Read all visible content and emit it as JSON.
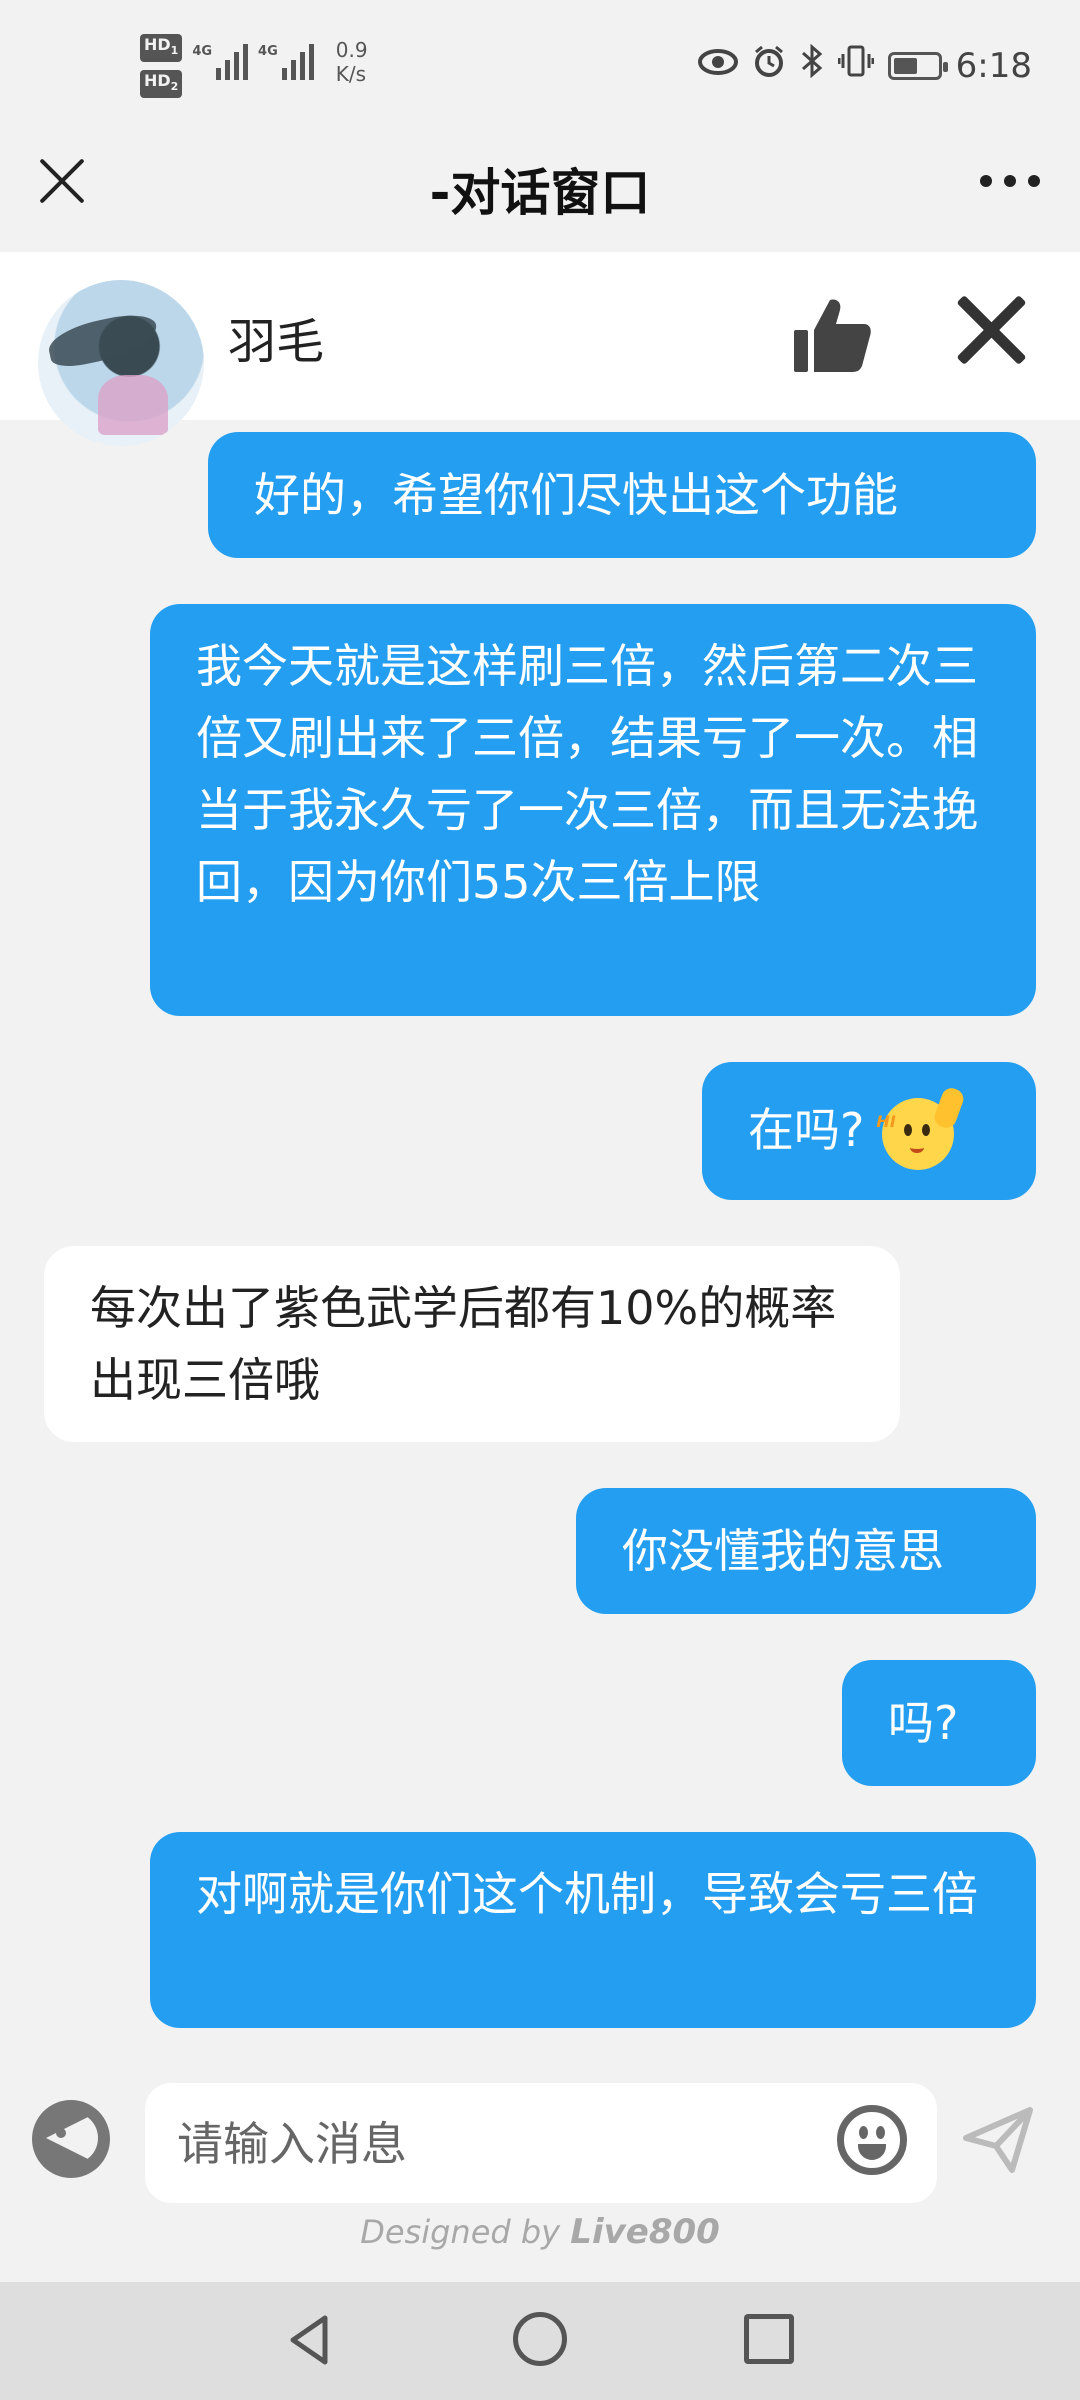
{
  "status_bar": {
    "hd1": "HD",
    "hd1_sub": "1",
    "hd2": "HD",
    "hd2_sub": "2",
    "net1": "4G",
    "net2": "4G",
    "speed_value": "0.9",
    "speed_unit": "K/s",
    "time": "6:18",
    "battery_level": 0.55
  },
  "title_bar": {
    "title": "-对话窗口"
  },
  "agent": {
    "name": "羽毛"
  },
  "messages": [
    {
      "side": "out",
      "text": "好的，希望你们尽快出这个功能"
    },
    {
      "side": "out",
      "text": "我今天就是这样刷三倍，然后第二次三倍又刷出来了三倍，结果亏了一次。相当于我永久亏了一次三倍，而且无法挽回，因为你们55次三倍上限"
    },
    {
      "side": "out",
      "text": "在吗?",
      "emoji": "hi-wave-emoji",
      "emoji_label": "HI"
    },
    {
      "side": "in",
      "text": "每次出了紫色武学后都有10%的概率出现三倍哦"
    },
    {
      "side": "out",
      "text": "你没懂我的意思"
    },
    {
      "side": "out",
      "text": "吗?"
    },
    {
      "side": "out",
      "text": "对啊就是你们这个机制，导致会亏三倍"
    }
  ],
  "input": {
    "placeholder": "请输入消息",
    "value": ""
  },
  "footer": {
    "designed_by": "Designed by",
    "brand": "Live800"
  },
  "colors": {
    "outgoing_bubble": "#249ef0",
    "incoming_bubble": "#ffffff",
    "background": "#f2f2f2"
  }
}
